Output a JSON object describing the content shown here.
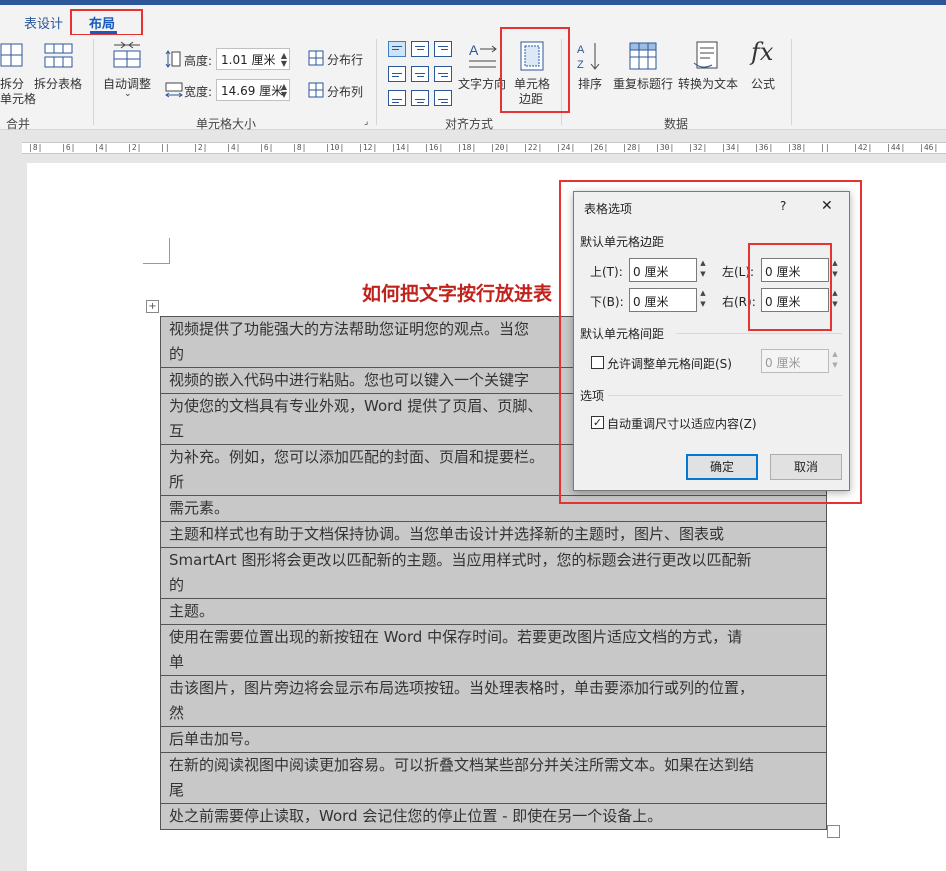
{
  "tabs": {
    "table_design": "表设计",
    "layout": "布局"
  },
  "ribbon": {
    "split_cells": "拆分\n单元格",
    "split_cells_top": "拆分",
    "split_cells_bottom": "单元格",
    "split_table": "拆分表格",
    "merge_group": "合并",
    "autofit": "自动调整",
    "height_label": "高度:",
    "height_value": "1.01 厘米",
    "width_label": "宽度:",
    "width_value": "14.69 厘米",
    "distribute_rows": "分布行",
    "distribute_cols": "分布列",
    "cell_size_group": "单元格大小",
    "text_direction": "文字方向",
    "cell_margins_top": "单元格",
    "cell_margins_bottom": "边距",
    "alignment_group": "对齐方式",
    "sort": "排序",
    "repeat_header": "重复标题行",
    "convert_to_text": "转换为文本",
    "formula": "公式",
    "data_group": "数据"
  },
  "ruler_ticks": [
    "8",
    "6",
    "4",
    "2",
    "",
    "2",
    "4",
    "6",
    "8",
    "10",
    "12",
    "14",
    "16",
    "18",
    "20",
    "22",
    "24",
    "26",
    "28",
    "30",
    "32",
    "34",
    "36",
    "38",
    "",
    "42",
    "44",
    "46"
  ],
  "document": {
    "title": "如何把文字按行放进表",
    "rows": [
      "视频提供了功能强大的方法帮助您证明您的观点。当您单击联机视频时，可以在想要添加的视频的",
      "视频的嵌入代码中进行粘贴。您也可以键入一个关键字以联机搜索最适合您的文档的视频。",
      "为使您的文档具有专业外观，Word 提供了页眉、页脚、封面和文本框设计，这些设计可互",
      "为补充。例如，您可以添加匹配的封面、页眉和提要栏。单击“插入”，然后从不同库中选择所",
      "需元素。",
      "主题和样式也有助于文档保持协调。当您单击设计并选择新的主题时，图片、图表或",
      "SmartArt 图形将会更改以匹配新的主题。当应用样式时，您的标题会进行更改以匹配新的",
      "主题。",
      "使用在需要位置出现的新按钮在 Word 中保存时间。若要更改图片适应文档的方式，请单",
      "击该图片，图片旁边将会显示布局选项按钮。当处理表格时，单击要添加行或列的位置，然",
      "后单击加号。",
      "在新的阅读视图中阅读更加容易。可以折叠文档某些部分并关注所需文本。如果在达到结尾",
      "处之前需要停止读取，Word 会记住您的停止位置 - 即使在另一个设备上。"
    ],
    "rows_visible": [
      [
        "视频提供了功能强大的方法帮助您证明您的观点。当您",
        "的"
      ],
      [
        "视频的嵌入代码中进行粘贴。您也可以键入一个关键字"
      ],
      [
        "为使您的文档具有专业外观，Word 提供了页眉、页脚、",
        "互"
      ],
      [
        "为补充。例如，您可以添加匹配的封面、页眉和提要栏。",
        "所"
      ],
      [
        "需元素。"
      ],
      [
        "主题和样式也有助于文档保持协调。当您单击设计并选择新的主题时，图片、图表或"
      ],
      [
        "SmartArt 图形将会更改以匹配新的主题。当应用样式时，您的标题会进行更改以匹配新",
        "的"
      ],
      [
        "主题。"
      ],
      [
        "使用在需要位置出现的新按钮在 Word 中保存时间。若要更改图片适应文档的方式，请",
        "单"
      ],
      [
        "击该图片，图片旁边将会显示布局选项按钮。当处理表格时，单击要添加行或列的位置，",
        "然"
      ],
      [
        "后单击加号。"
      ],
      [
        "在新的阅读视图中阅读更加容易。可以折叠文档某些部分并关注所需文本。如果在达到结",
        "尾"
      ],
      [
        "处之前需要停止读取，Word 会记住您的停止位置 - 即使在另一个设备上。"
      ]
    ]
  },
  "dialog": {
    "title": "表格选项",
    "help": "?",
    "close": "✕",
    "margins_section": "默认单元格边距",
    "top_label": "上(T):",
    "top_value": "0 厘米",
    "bottom_label": "下(B):",
    "bottom_value": "0 厘米",
    "left_label": "左(L):",
    "left_value": "0 厘米",
    "right_label": "右(R):",
    "right_value": "0 厘米",
    "spacing_section": "默认单元格间距",
    "allow_spacing_label": "允许调整单元格间距(S)",
    "allow_spacing_checked": false,
    "spacing_value": "0 厘米",
    "options_section": "选项",
    "autoresize_label": "自动重调尺寸以适应内容(Z)",
    "autoresize_checked": true,
    "ok": "确定",
    "cancel": "取消"
  },
  "colors": {
    "accent": "#185abd",
    "highlight_box": "#e53333",
    "title_red": "#c0221c",
    "table_fill": "#c8c8c8"
  }
}
